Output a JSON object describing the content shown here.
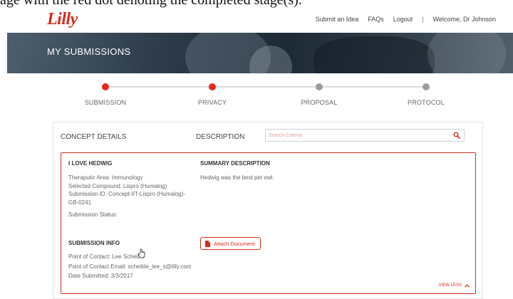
{
  "caption": {
    "text": "age with the red dot denoting the completed stage(s)."
  },
  "brand": {
    "logo_text": "Lilly",
    "accent_color": "#d52b1e"
  },
  "nav": {
    "submit_idea": "Submit an Idea",
    "faqs": "FAQs",
    "logout": "Logout",
    "separator": "|",
    "welcome": "Welcome, Dr Johnson"
  },
  "hero": {
    "title": "MY SUBMISSIONS"
  },
  "stepper": {
    "steps": [
      {
        "label": "SUBMISSION",
        "completed": true
      },
      {
        "label": "PRIVACY",
        "completed": true
      },
      {
        "label": "PROPOSAL",
        "completed": false
      },
      {
        "label": "PROTOCOL",
        "completed": false
      }
    ],
    "completed_color": "#e8261c",
    "pending_color": "#9c9c9c"
  },
  "panel": {
    "concept_details_label": "CONCEPT DETAILS",
    "description_label": "DESCRIPTION",
    "search": {
      "placeholder": "Search Criteria",
      "value": "",
      "icon": "search-icon"
    }
  },
  "card": {
    "title": "I LOVE HEDWIG",
    "therapeutic_area": "Theraputic Area: Immunology",
    "selected_compound": "Selected Compound: Lispro (Humalog)",
    "submission_id": "Submission ID: Concept-IIT-Lispro (Humalog)-GB-0241",
    "submission_status": "Submission Status:",
    "summary_title": "SUMMARY DESCRIPTION",
    "summary_text": "Hedwig was the best pet owl.",
    "submission_info_title": "SUBMISSION INFO",
    "point_of_contact": "Point of Contact: Lee Scheible",
    "contact_email": "Point of Contact Email: scheible_lee_s@lilly.com",
    "date_submitted": "Date Submitted: 3/3/2017",
    "attach_button": "Attach Document",
    "attach_icon": "document-icon",
    "view_less": "VIEW LESS",
    "view_less_icon": "chevron-up-icon"
  }
}
